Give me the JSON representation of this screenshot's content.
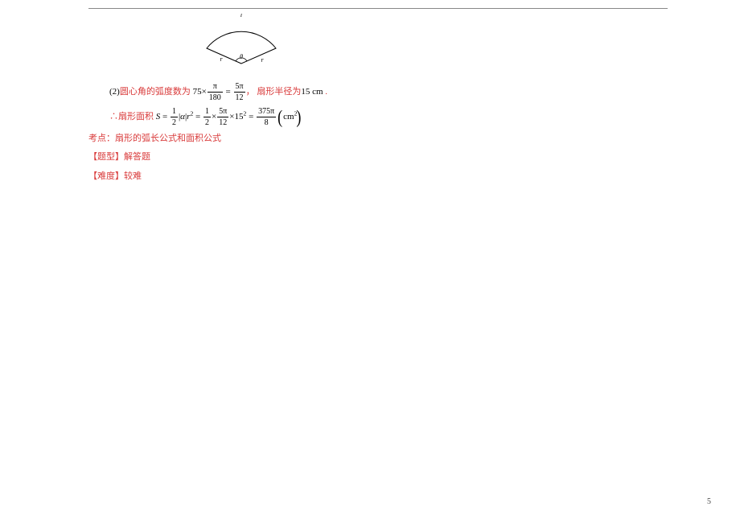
{
  "diagram": {
    "label_l": "l",
    "label_theta": "θ",
    "label_r_left": "r",
    "label_r_right": "r"
  },
  "line_angle": {
    "prefix": "(2)",
    "text_a": "圆心角的弧度数为",
    "num_a": "75",
    "frac1_num": "π",
    "frac1_den": "180",
    "eq": "=",
    "frac2_num": "5π",
    "frac2_den": "12",
    "comma": "，",
    "text_b": "扇形半径为",
    "radius": "15 cm",
    "period": "."
  },
  "line_area": {
    "prefix": "∴",
    "label": "扇形面积",
    "S": "S",
    "eq1": "=",
    "half_num": "1",
    "half_den": "2",
    "abs_open": "|",
    "alpha": "α",
    "abs_close": "|",
    "r": "r",
    "sq1": "2",
    "eq2": "=",
    "f2a_num": "1",
    "f2a_den": "2",
    "times1": "×",
    "f2b_num": "5π",
    "f2b_den": "12",
    "times2": "×",
    "r15": "15",
    "sq2": "2",
    "eq3": "=",
    "f3_num": "375π",
    "f3_den": "8",
    "unit": "cm",
    "unit_sup": "2"
  },
  "keypoint": {
    "label": "考点：",
    "text": "扇形的弧长公式和面积公式"
  },
  "qtype": {
    "label": "【题型】",
    "text": "解答题"
  },
  "difficulty": {
    "label": "【难度】",
    "text": "较难"
  },
  "page_number": "5"
}
